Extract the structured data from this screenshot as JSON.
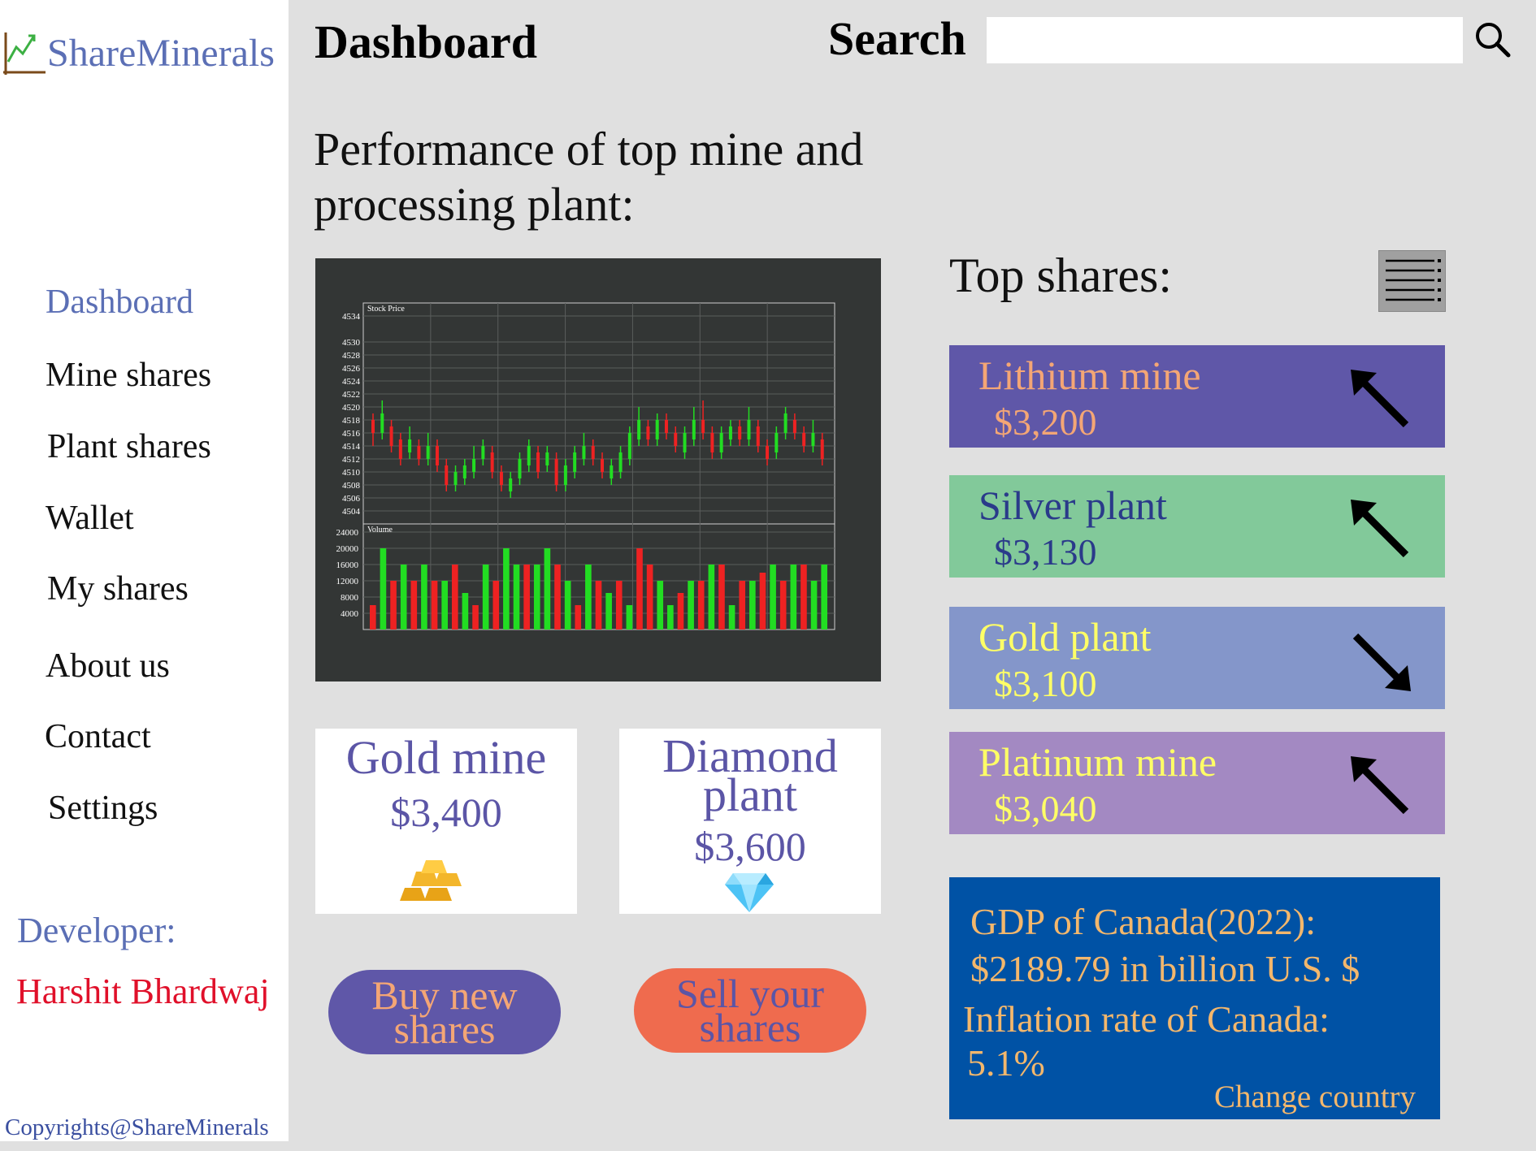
{
  "brand": {
    "name": "ShareMinerals"
  },
  "header": {
    "title": "Dashboard",
    "search_label": "Search",
    "search_value": "",
    "search_icon": "search-icon"
  },
  "sidebar": {
    "items": [
      {
        "label": "Dashboard",
        "active": true
      },
      {
        "label": "Mine shares"
      },
      {
        "label": "Plant shares"
      },
      {
        "label": "Wallet"
      },
      {
        "label": "My shares"
      },
      {
        "label": "About us"
      },
      {
        "label": "Contact"
      },
      {
        "label": "Settings"
      }
    ],
    "developer_label": "Developer:",
    "developer_name": "Harshit Bhardwaj",
    "copyright": "Copyrights@ShareMinerals"
  },
  "main": {
    "performance_title": "Performance of top mine and processing plant:",
    "cards": [
      {
        "name": "Gold mine",
        "price": "$3,400",
        "icon": "gold-bars-icon"
      },
      {
        "name": "Diamond plant",
        "price": "$3,600",
        "icon": "diamond-icon"
      }
    ],
    "buy_label": "Buy new shares",
    "sell_label": "Sell your shares"
  },
  "top_shares": {
    "title": "Top shares:",
    "items": [
      {
        "name": "Lithium mine",
        "price": "$3,200",
        "trend": "up",
        "bg": "#5f57a8",
        "fg": "#f4a675"
      },
      {
        "name": "Silver plant",
        "price": "$3,130",
        "trend": "up",
        "bg": "#82c99a",
        "fg": "#2a3a8a"
      },
      {
        "name": "Gold plant",
        "price": "$3,100",
        "trend": "down",
        "bg": "#8496ca",
        "fg": "#ffff66"
      },
      {
        "name": "Platinum mine",
        "price": "$3,040",
        "trend": "up",
        "bg": "#a389c2",
        "fg": "#ffff66"
      }
    ]
  },
  "info": {
    "gdp_label": "GDP of Canada(2022):",
    "gdp_value": "$2189.79 in billion U.S. $",
    "inflation_label": "Inflation rate of Canada:",
    "inflation_value": "5.1%",
    "change_country": "Change country"
  },
  "chart_data": {
    "type": "candlestick",
    "price_panel_label": "Stock Price",
    "volume_panel_label": "Volume",
    "price_ticks": [
      4534,
      4530,
      4528,
      4526,
      4524,
      4522,
      4520,
      4518,
      4516,
      4514,
      4512,
      4510,
      4508,
      4506,
      4504
    ],
    "volume_ticks": [
      24000,
      20000,
      16000,
      12000,
      8000,
      4000
    ],
    "colors": {
      "up": "#22dd22",
      "down": "#ee2222",
      "background": "#333635"
    },
    "candles": [
      {
        "o": 4518,
        "c": 4516,
        "h": 4519,
        "l": 4514
      },
      {
        "o": 4516,
        "c": 4519,
        "h": 4521,
        "l": 4515
      },
      {
        "o": 4517,
        "c": 4514,
        "h": 4518,
        "l": 4513
      },
      {
        "o": 4515,
        "c": 4512,
        "h": 4516,
        "l": 4511
      },
      {
        "o": 4513,
        "c": 4515,
        "h": 4517,
        "l": 4512
      },
      {
        "o": 4514,
        "c": 4512,
        "h": 4515,
        "l": 4511
      },
      {
        "o": 4512,
        "c": 4514,
        "h": 4516,
        "l": 4511
      },
      {
        "o": 4514,
        "c": 4511,
        "h": 4515,
        "l": 4510
      },
      {
        "o": 4511,
        "c": 4508,
        "h": 4512,
        "l": 4507
      },
      {
        "o": 4508,
        "c": 4510,
        "h": 4511,
        "l": 4507
      },
      {
        "o": 4509,
        "c": 4511,
        "h": 4512,
        "l": 4508
      },
      {
        "o": 4510,
        "c": 4512,
        "h": 4514,
        "l": 4509
      },
      {
        "o": 4512,
        "c": 4514,
        "h": 4515,
        "l": 4511
      },
      {
        "o": 4513,
        "c": 4510,
        "h": 4514,
        "l": 4509
      },
      {
        "o": 4510,
        "c": 4508,
        "h": 4511,
        "l": 4507
      },
      {
        "o": 4507,
        "c": 4509,
        "h": 4510,
        "l": 4506
      },
      {
        "o": 4509,
        "c": 4512,
        "h": 4513,
        "l": 4508
      },
      {
        "o": 4511,
        "c": 4514,
        "h": 4515,
        "l": 4510
      },
      {
        "o": 4513,
        "c": 4510,
        "h": 4514,
        "l": 4509
      },
      {
        "o": 4511,
        "c": 4513,
        "h": 4514,
        "l": 4510
      },
      {
        "o": 4512,
        "c": 4508,
        "h": 4513,
        "l": 4507
      },
      {
        "o": 4508,
        "c": 4511,
        "h": 4512,
        "l": 4507
      },
      {
        "o": 4510,
        "c": 4513,
        "h": 4514,
        "l": 4509
      },
      {
        "o": 4512,
        "c": 4514,
        "h": 4516,
        "l": 4511
      },
      {
        "o": 4514,
        "c": 4512,
        "h": 4515,
        "l": 4511
      },
      {
        "o": 4512,
        "c": 4510,
        "h": 4513,
        "l": 4509
      },
      {
        "o": 4509,
        "c": 4511,
        "h": 4512,
        "l": 4508
      },
      {
        "o": 4510,
        "c": 4513,
        "h": 4514,
        "l": 4509
      },
      {
        "o": 4512,
        "c": 4516,
        "h": 4517,
        "l": 4511
      },
      {
        "o": 4515,
        "c": 4518,
        "h": 4520,
        "l": 4514
      },
      {
        "o": 4517,
        "c": 4515,
        "h": 4518,
        "l": 4514
      },
      {
        "o": 4515,
        "c": 4518,
        "h": 4519,
        "l": 4514
      },
      {
        "o": 4518,
        "c": 4516,
        "h": 4519,
        "l": 4515
      },
      {
        "o": 4516,
        "c": 4514,
        "h": 4517,
        "l": 4513
      },
      {
        "o": 4513,
        "c": 4516,
        "h": 4517,
        "l": 4512
      },
      {
        "o": 4515,
        "c": 4518,
        "h": 4520,
        "l": 4514
      },
      {
        "o": 4518,
        "c": 4516,
        "h": 4521,
        "l": 4515
      },
      {
        "o": 4516,
        "c": 4513,
        "h": 4517,
        "l": 4512
      },
      {
        "o": 4513,
        "c": 4516,
        "h": 4517,
        "l": 4512
      },
      {
        "o": 4515,
        "c": 4517,
        "h": 4518,
        "l": 4514
      },
      {
        "o": 4517,
        "c": 4515,
        "h": 4518,
        "l": 4514
      },
      {
        "o": 4515,
        "c": 4518,
        "h": 4520,
        "l": 4514
      },
      {
        "o": 4517,
        "c": 4514,
        "h": 4518,
        "l": 4513
      },
      {
        "o": 4514,
        "c": 4512,
        "h": 4515,
        "l": 4511
      },
      {
        "o": 4513,
        "c": 4516,
        "h": 4517,
        "l": 4512
      },
      {
        "o": 4516,
        "c": 4519,
        "h": 4520,
        "l": 4515
      },
      {
        "o": 4518,
        "c": 4516,
        "h": 4519,
        "l": 4515
      },
      {
        "o": 4516,
        "c": 4514,
        "h": 4517,
        "l": 4513
      },
      {
        "o": 4514,
        "c": 4516,
        "h": 4518,
        "l": 4513
      },
      {
        "o": 4515,
        "c": 4512,
        "h": 4516,
        "l": 4511
      }
    ],
    "volumes": [
      {
        "v": 6000,
        "up": false
      },
      {
        "v": 20000,
        "up": true
      },
      {
        "v": 12000,
        "up": false
      },
      {
        "v": 16000,
        "up": true
      },
      {
        "v": 12000,
        "up": false
      },
      {
        "v": 16000,
        "up": true
      },
      {
        "v": 12000,
        "up": false
      },
      {
        "v": 12000,
        "up": true
      },
      {
        "v": 16000,
        "up": false
      },
      {
        "v": 9000,
        "up": true
      },
      {
        "v": 6000,
        "up": false
      },
      {
        "v": 16000,
        "up": true
      },
      {
        "v": 12000,
        "up": false
      },
      {
        "v": 20000,
        "up": true
      },
      {
        "v": 16000,
        "up": true
      },
      {
        "v": 16000,
        "up": false
      },
      {
        "v": 16000,
        "up": true
      },
      {
        "v": 20000,
        "up": true
      },
      {
        "v": 16000,
        "up": false
      },
      {
        "v": 12000,
        "up": true
      },
      {
        "v": 6000,
        "up": false
      },
      {
        "v": 16000,
        "up": true
      },
      {
        "v": 12000,
        "up": false
      },
      {
        "v": 9000,
        "up": true
      },
      {
        "v": 12000,
        "up": false
      },
      {
        "v": 6000,
        "up": true
      },
      {
        "v": 20000,
        "up": false
      },
      {
        "v": 16000,
        "up": false
      },
      {
        "v": 12000,
        "up": true
      },
      {
        "v": 6000,
        "up": true
      },
      {
        "v": 9000,
        "up": false
      },
      {
        "v": 12000,
        "up": true
      },
      {
        "v": 12000,
        "up": false
      },
      {
        "v": 16000,
        "up": true
      },
      {
        "v": 16000,
        "up": false
      },
      {
        "v": 6000,
        "up": true
      },
      {
        "v": 12000,
        "up": false
      },
      {
        "v": 12000,
        "up": true
      },
      {
        "v": 14000,
        "up": false
      },
      {
        "v": 16000,
        "up": true
      },
      {
        "v": 12000,
        "up": false
      },
      {
        "v": 16000,
        "up": true
      },
      {
        "v": 16000,
        "up": false
      },
      {
        "v": 12000,
        "up": true
      },
      {
        "v": 16000,
        "up": true
      }
    ]
  }
}
